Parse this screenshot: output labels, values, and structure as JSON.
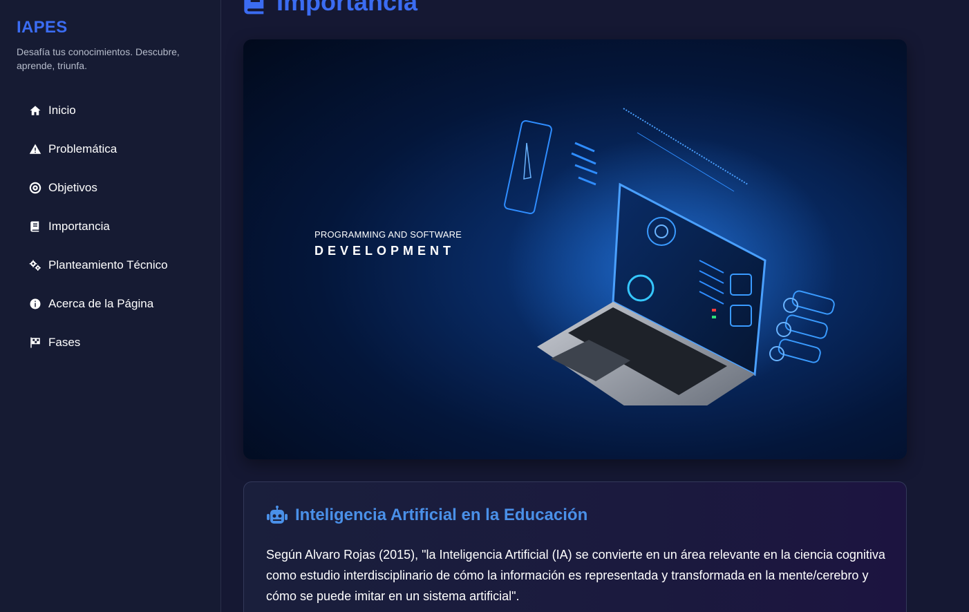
{
  "sidebar": {
    "brand": "IAPES",
    "tagline": "Desafía tus conocimientos. Descubre, aprende, triunfa.",
    "items": [
      {
        "label": "Inicio",
        "icon": "home-icon"
      },
      {
        "label": "Problemática",
        "icon": "warning-icon"
      },
      {
        "label": "Objetivos",
        "icon": "target-icon"
      },
      {
        "label": "Importancia",
        "icon": "book-icon"
      },
      {
        "label": "Planteamiento Técnico",
        "icon": "gears-icon"
      },
      {
        "label": "Acerca de la Página",
        "icon": "info-icon"
      },
      {
        "label": "Fases",
        "icon": "flag-checkered-icon"
      }
    ]
  },
  "main": {
    "title": "Importancia",
    "title_icon": "book-icon",
    "hero": {
      "caption_small": "PROGRAMMING AND SOFTWARE",
      "caption_big": "DEVELOPMENT"
    },
    "card": {
      "icon": "robot-icon",
      "title": "Inteligencia Artificial en la Educación",
      "body": "Según Alvaro Rojas (2015), \"la Inteligencia Artificial (IA) se convierte en un área relevante en la ciencia cognitiva como estudio interdisciplinario de cómo la información es representada y transformada en la mente/cerebro y cómo se puede imitar en un sistema artificial\"."
    }
  },
  "colors": {
    "accent": "#3b6cf2",
    "card_title": "#4a90e8",
    "sidebar_bg": "#161b33",
    "page_bg": "#151833"
  }
}
